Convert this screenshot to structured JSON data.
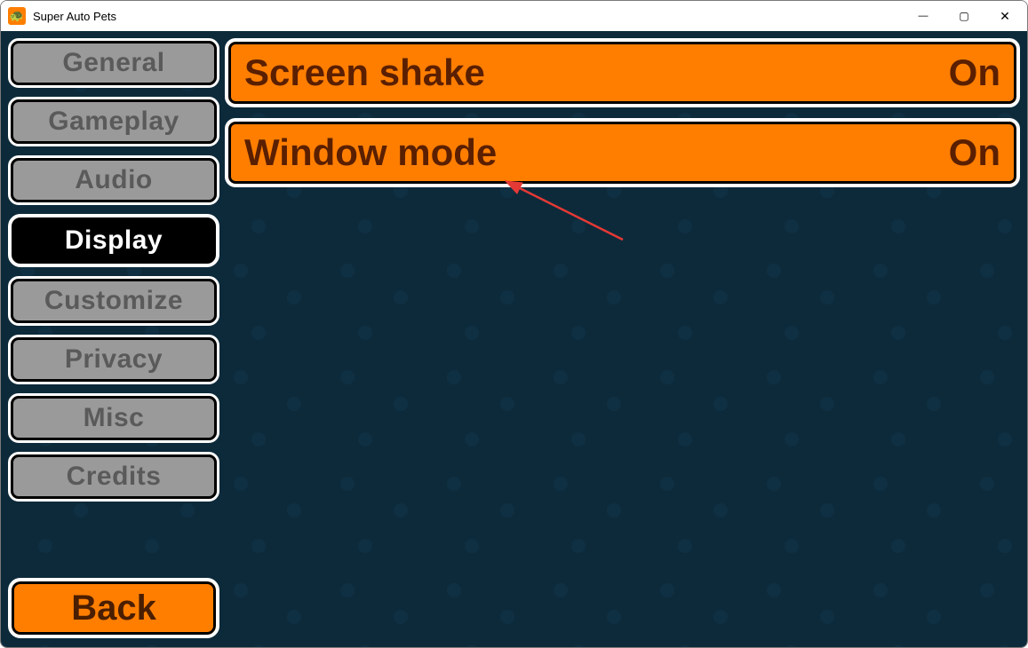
{
  "window": {
    "title": "Super Auto Pets",
    "icon_glyph": "🐢",
    "controls": {
      "minimize": "—",
      "maximize": "▢",
      "close": "✕"
    }
  },
  "sidebar": {
    "items": [
      {
        "label": "General",
        "selected": false
      },
      {
        "label": "Gameplay",
        "selected": false
      },
      {
        "label": "Audio",
        "selected": false
      },
      {
        "label": "Display",
        "selected": true
      },
      {
        "label": "Customize",
        "selected": false
      },
      {
        "label": "Privacy",
        "selected": false
      },
      {
        "label": "Misc",
        "selected": false
      },
      {
        "label": "Credits",
        "selected": false
      }
    ],
    "back_label": "Back"
  },
  "settings": [
    {
      "label": "Screen shake",
      "value": "On"
    },
    {
      "label": "Window mode",
      "value": "On"
    }
  ],
  "colors": {
    "accent": "#ff7e00",
    "bg": "#0d2a3a",
    "text_dark": "#5a1f00"
  }
}
